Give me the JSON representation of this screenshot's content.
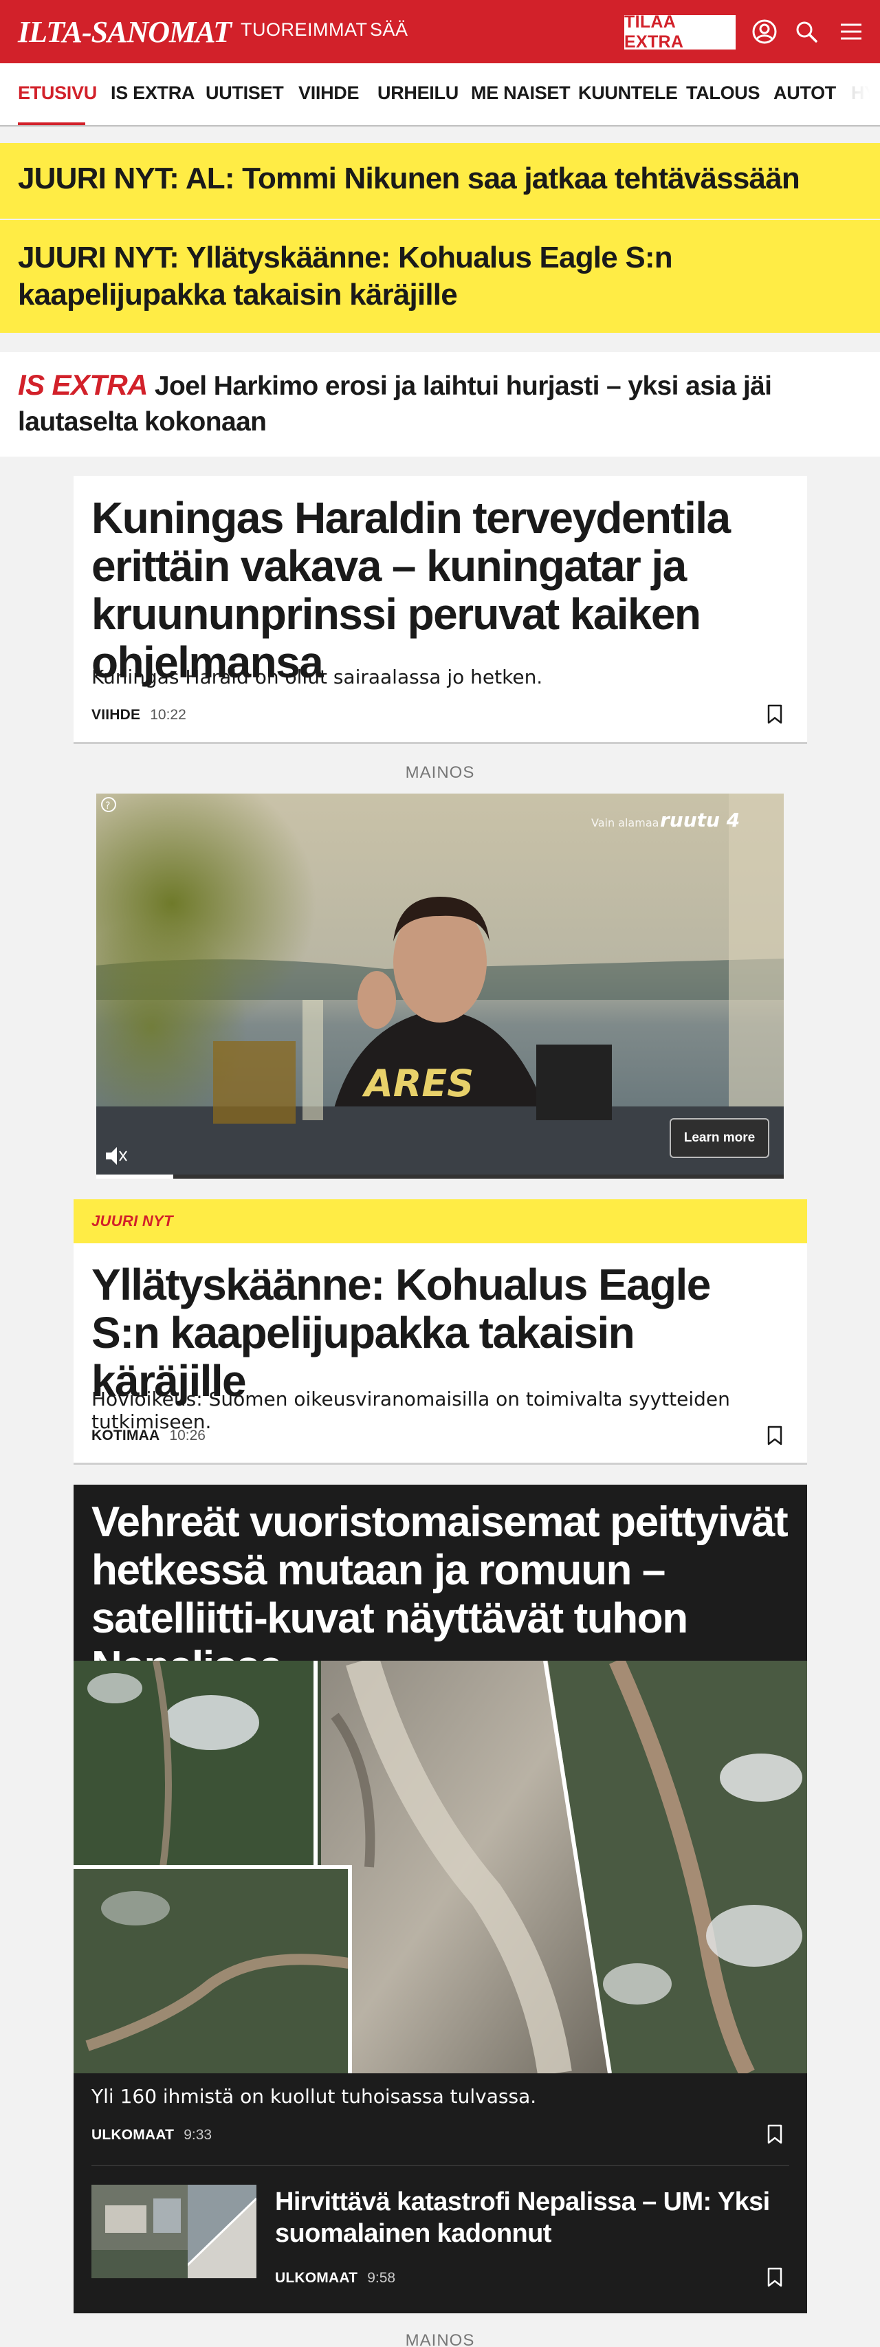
{
  "header": {
    "logo": "ILTA-SANOMAT",
    "nav_latest": "TUOREIMMAT",
    "nav_weather": "SÄÄ",
    "subscribe": "TILAA EXTRA",
    "icons": [
      "user-icon",
      "search-icon",
      "menu-icon"
    ],
    "brand_color": "#d2212a"
  },
  "sections": [
    "ETUSIVU",
    "IS EXTRA",
    "UUTISET",
    "VIIHDE",
    "URHEILU",
    "ME NAISET",
    "KUUNTELE",
    "TALOUS",
    "AUTOT",
    "HY"
  ],
  "breaking": [
    "JUURI NYT: AL: Tommi Nikunen saa jatkaa tehtävässään",
    "JUURI NYT: Yllätyskäänne: Kohualus Eagle S:n kaapelijupakka takaisin käräjille"
  ],
  "extra_banner": {
    "tag": "IS EXTRA",
    "text": "Joel Harkimo erosi ja laihtui hurjasti – yksi asia jäi lautaselta kokonaan"
  },
  "articles": [
    {
      "title": "Kuningas Haraldin terveydentila erittäin vakava – kuningatar ja kruununprinssi peruvat kaiken ohjelmansa",
      "lead": "Kuningas Harald on ollut sairaalassa jo hetken.",
      "category": "VIIHDE",
      "time": "10:22"
    },
    {
      "tag": "JUURI NYT",
      "title": "Yllätyskäänne: Kohualus Eagle S:n kaapelijupakka takaisin käräjille",
      "lead": "Hovioikeus: Suomen oikeusviranomaisilla on toimivalta syytteiden tutkimiseen.",
      "category": "KOTIMAA",
      "time": "10:26"
    },
    {
      "title": "Vehreät vuoristomaisemat peittyivät hetkessä mutaan ja romuun – satelliitti-kuvat näyttävät tuhon Nepalissa",
      "lead": "Yli 160 ihmistä on kuollut tuhoisassa tulvassa.",
      "category": "ULKOMAAT",
      "time": "9:33",
      "related": {
        "title": "Hirvittävä katastrofi Nepalissa – UM: Yksi suomalainen kadonnut",
        "category": "ULKOMAAT",
        "time": "9:58"
      }
    }
  ],
  "ads": {
    "label": "MAINOS",
    "video_overlay": "ARES",
    "brand_line": "Vain alamaa",
    "brand": "ruutu 4",
    "cta": "Learn more",
    "help_icon": "question-icon",
    "mute_icon": "mute-icon"
  }
}
